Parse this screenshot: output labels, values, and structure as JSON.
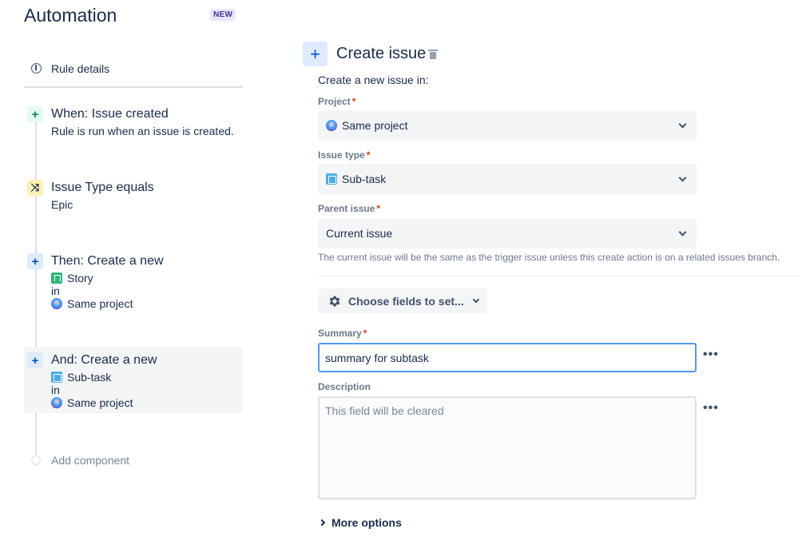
{
  "header": {
    "title": "Automation",
    "badge": "NEW"
  },
  "sidebar": {
    "rule_details": {
      "icon": "info-icon",
      "label": "Rule details"
    },
    "components": [
      {
        "badge": "+",
        "title": "When: Issue created",
        "lines": [
          "Rule is run when an issue is created."
        ]
      },
      {
        "badge": "⤨",
        "title": "Issue Type equals",
        "lines": [
          "Epic"
        ]
      },
      {
        "badge": "+",
        "title": "Then: Create a new",
        "issue_type": "Story",
        "in": "in",
        "project": "Same project"
      },
      {
        "badge": "+",
        "title": "And: Create a new",
        "issue_type": "Sub-task",
        "in": "in",
        "project": "Same project"
      }
    ],
    "add_component": "Add component"
  },
  "main": {
    "icon": "+",
    "title": "Create issue",
    "create_in": "Create a new issue in:",
    "fields": {
      "project": {
        "label": "Project",
        "required": "*",
        "value": "Same project"
      },
      "issue_type": {
        "label": "Issue type",
        "required": "*",
        "value": "Sub-task"
      },
      "parent_issue": {
        "label": "Parent issue",
        "required": "*",
        "value": "Current issue",
        "helper": "The current issue will be the same as the trigger issue unless this create action is on a related issues branch."
      },
      "choose_fields": "Choose fields to set...",
      "summary": {
        "label": "Summary",
        "required": "*",
        "value": "summary for subtask"
      },
      "description": {
        "label": "Description",
        "placeholder": "This field will be cleared"
      }
    },
    "more_menu": "•••",
    "more_options": "More options"
  },
  "colors": {
    "accent": "#0052cc",
    "focus_border": "#4c9aff",
    "required": "#de350b",
    "badge_purple": "#403294"
  }
}
